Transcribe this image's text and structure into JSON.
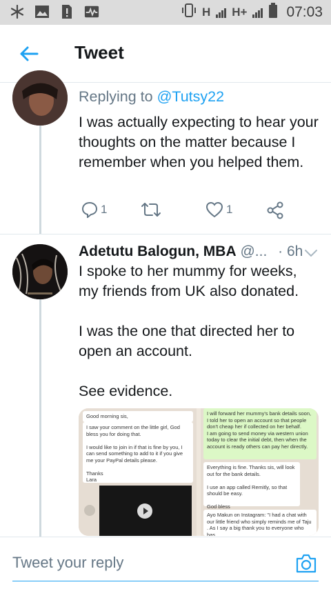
{
  "status_bar": {
    "icons_left": [
      "snowflake-icon",
      "image-icon",
      "sim-alert-icon",
      "activity-icon"
    ],
    "network_1": "H",
    "network_2": "H+",
    "time": "07:03"
  },
  "header": {
    "title": "Tweet",
    "back_icon": "arrow-left-icon"
  },
  "tweet_1": {
    "replying_prefix": "Replying to",
    "replying_handle": "@Tutsy22",
    "text": "I was actually expecting to hear your thoughts on the matter because I remember when you helped them.",
    "reply_count": "1",
    "retweet_count": "",
    "like_count": "1"
  },
  "tweet_2": {
    "author_name": "Adetutu Balogun, MBA",
    "handle": "@...",
    "separator": "·",
    "time": "6h",
    "text": "I spoke to her mummy for weeks, my friends from UK also donated.\n\nI was the one that directed her to open an account.\n\nSee evidence.",
    "media": {
      "left_chat": [
        "Good morning sis,",
        "I saw your comment on the little girl, God bless you for doing that.\n\nI would like to join in if that is fine by you, I can send something to add to it if you give me your PayPal details please.\n\nThanks\nLara"
      ],
      "right_chat": [
        "I will forward her mummy's bank details soon, I told her to open an account so that people don't cheap her if collected on her behalf.\nI am going to send money via western union today to clear the initial debt, then when the account is ready others can pay her directly.",
        "Everything is fine. Thanks sis, will look out for the bank details.\n\nI use an app called Remitly, so that should be easy.\n\nGod bless",
        "Ayo Makun on Instagram: \"I had a chat with our little friend who simply reminds me of Taju . As I say a big thank you to everyone who has"
      ]
    }
  },
  "reply_bar": {
    "placeholder": "Tweet your reply",
    "camera_icon": "camera-icon"
  },
  "colors": {
    "accent": "#1da1f2",
    "text": "#14171a",
    "muted": "#657786",
    "status_bar_bg": "#dcdcdc"
  }
}
